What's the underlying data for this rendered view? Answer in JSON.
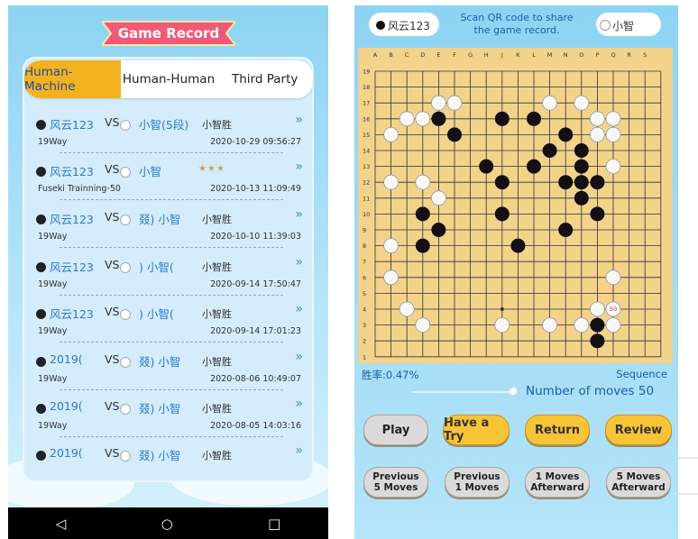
{
  "left": {
    "title": "Game Record",
    "tabs": [
      "Human-Machine",
      "Human-Human",
      "Third Party"
    ],
    "records": [
      {
        "player1": "风云123",
        "vs": "VS",
        "player2": "小智(5段)",
        "result": "小智胜",
        "subtitle": "19Way",
        "date": "2020-10-29 09:56:27",
        "stars": ""
      },
      {
        "player1": "风云123",
        "vs": "VS",
        "player2": "小智",
        "result": "",
        "subtitle": "Fuseki Trainning-50",
        "date": "2020-10-13 11:09:49",
        "stars": "★★★"
      },
      {
        "player1": "风云123",
        "vs": "VS",
        "player2": "叕)     小智",
        "result": "小智胜",
        "subtitle": "19Way",
        "date": "2020-10-10 11:39:03",
        "stars": ""
      },
      {
        "player1": "风云123",
        "vs": "VS",
        "player2": ")     小智(",
        "result": "小智胜",
        "subtitle": "19Way",
        "date": "2020-09-14 17:50:47",
        "stars": ""
      },
      {
        "player1": "风云123",
        "vs": "VS",
        "player2": ")     小智(",
        "result": "小智胜",
        "subtitle": "19Way",
        "date": "2020-09-14 17:01:23",
        "stars": ""
      },
      {
        "player1": "2019(",
        "vs": "VS",
        "player2": "叕)     小智",
        "result": "小智胜",
        "subtitle": "19Way",
        "date": "2020-08-06 10:49:07",
        "stars": ""
      },
      {
        "player1": "2019(",
        "vs": "VS",
        "player2": "叕)     小智",
        "result": "小智胜",
        "subtitle": "19Way",
        "date": "2020-08-05 14:03:16",
        "stars": ""
      },
      {
        "player1": "2019(",
        "vs": "VS",
        "player2": "叕)     小智",
        "result": "小智胜",
        "subtitle": "",
        "date": "",
        "stars": ""
      }
    ],
    "nav": {
      "back": "◁",
      "home": "○",
      "recent": "□"
    }
  },
  "right": {
    "player_black": "风云123",
    "player_white": "小智",
    "qr_text": "Scan QR code to share the game record.",
    "win_rate": "胜率:0.47%",
    "sequence_label": "Sequence",
    "moves_label": "Number of moves",
    "moves_value": "50",
    "last_move_label": "50",
    "buttons": {
      "play": "Play",
      "have_a_try": "Have a Try",
      "return": "Return",
      "review": "Review",
      "prev5": "Previous\n5 Moves",
      "prev1": "Previous\n1 Moves",
      "next1": "1 Moves\nAfterward",
      "next5": "5 Moves\nAfterward"
    },
    "board": {
      "columns": [
        "A",
        "B",
        "C",
        "D",
        "E",
        "F",
        "G",
        "H",
        "J",
        "K",
        "L",
        "M",
        "N",
        "O",
        "P",
        "Q",
        "R",
        "S"
      ],
      "rows": [
        "19",
        "18",
        "17",
        "16",
        "15",
        "14",
        "13",
        "12",
        "11",
        "10",
        "9",
        "8",
        "7",
        "6",
        "5",
        "4",
        "3",
        "2",
        "1"
      ],
      "black": [
        "E16",
        "J16",
        "L16",
        "F15",
        "N15",
        "M14",
        "O14",
        "H13",
        "L13",
        "O13",
        "J12",
        "N12",
        "O12",
        "P12",
        "O11",
        "D10",
        "J10",
        "P10",
        "E9",
        "N9",
        "D8",
        "K8",
        "P3",
        "P2"
      ],
      "white": [
        "E17",
        "F17",
        "M17",
        "O17",
        "C16",
        "D16",
        "P16",
        "Q16",
        "B15",
        "P15",
        "Q15",
        "Q13",
        "B12",
        "D12",
        "E11",
        "B8",
        "Q6",
        "B6",
        "C4",
        "P4",
        "D3",
        "J3",
        "M3",
        "O3",
        "Q3"
      ],
      "last_black": "Q16",
      "last_move_point": "Q4",
      "star_point": "J4"
    },
    "colors": {
      "accent": "#f6c436",
      "board": "#f3d28a",
      "text_blue": "#1a5fa8"
    }
  }
}
